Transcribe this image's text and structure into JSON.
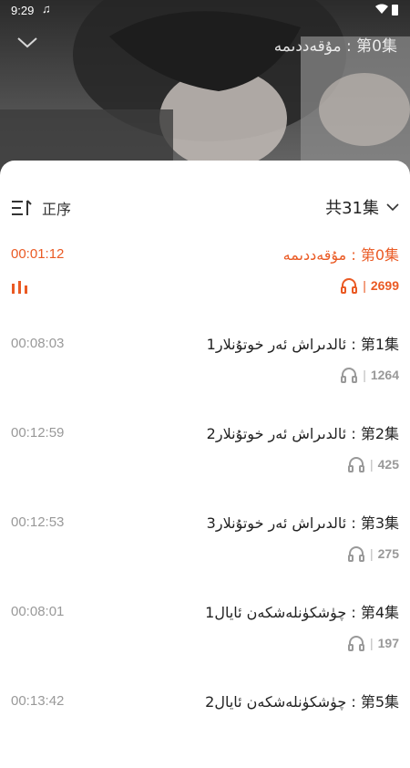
{
  "status_bar": {
    "time": "9:29",
    "music_glyph": "♫"
  },
  "header": {
    "title": "مۇقەددىمە : 第0集",
    "back_icon": "chevron-down-icon"
  },
  "sheet": {
    "sort_label": "正序",
    "count_label": "共31集",
    "accent_color": "#ea5a24"
  },
  "episodes": [
    {
      "title": "مۇقەددىمە : 第0集",
      "duration": "00:01:12",
      "plays": "2699",
      "active": true
    },
    {
      "title": "ئالدىراش ئەر خوتۇنلار1 : 第1集",
      "duration": "00:08:03",
      "plays": "1264",
      "active": false
    },
    {
      "title": "ئالدىراش ئەر خوتۇنلار2 : 第2集",
      "duration": "00:12:59",
      "plays": "425",
      "active": false
    },
    {
      "title": "ئالدىراش ئەر خوتۇنلار3 : 第3集",
      "duration": "00:12:53",
      "plays": "275",
      "active": false
    },
    {
      "title": "چۈشكۈنلەشكەن ئايال1 : 第4集",
      "duration": "00:08:01",
      "plays": "197",
      "active": false
    },
    {
      "title": "چۈشكۈنلەشكەن ئايال2 : 第5集",
      "duration": "00:13:42",
      "plays": "",
      "active": false
    }
  ]
}
